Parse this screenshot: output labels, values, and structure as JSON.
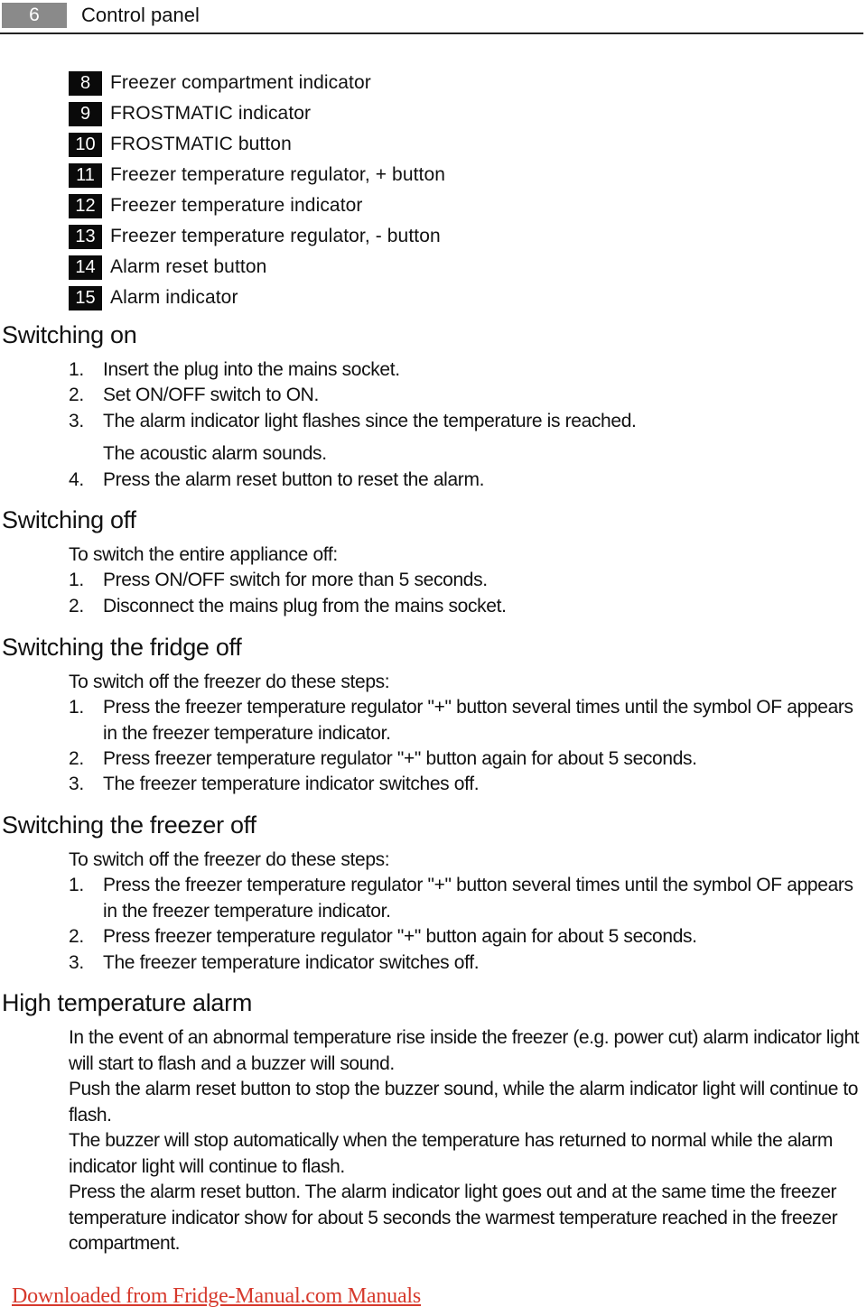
{
  "header": {
    "page_number": "6",
    "title": "Control panel"
  },
  "legend": [
    {
      "num": "8",
      "label": "Freezer compartment indicator"
    },
    {
      "num": "9",
      "label": "FROSTMATIC indicator"
    },
    {
      "num": "10",
      "label": "FROSTMATIC button"
    },
    {
      "num": "11",
      "label": "Freezer temperature regulator, + button"
    },
    {
      "num": "12",
      "label": "Freezer temperature indicator"
    },
    {
      "num": "13",
      "label": "Freezer temperature regulator, - button"
    },
    {
      "num": "14",
      "label": "Alarm reset button"
    },
    {
      "num": "15",
      "label": "Alarm indicator"
    }
  ],
  "switching_on": {
    "title": "Switching on",
    "steps": [
      {
        "n": "1.",
        "text": "Insert the plug into the mains socket."
      },
      {
        "n": "2.",
        "text": "Set ON/OFF switch to ON."
      },
      {
        "n": "3.",
        "text": "The alarm indicator light flashes since the temperature is reached."
      },
      {
        "n": "",
        "text": "The acoustic alarm sounds."
      },
      {
        "n": "4.",
        "text": "Press the alarm reset button to reset the alarm."
      }
    ]
  },
  "switching_off": {
    "title": "Switching off",
    "intro": "To switch the entire appliance off:",
    "steps": [
      {
        "n": "1.",
        "text": "Press ON/OFF switch for more than 5 seconds."
      },
      {
        "n": "2.",
        "text": "Disconnect the mains plug from the mains socket."
      }
    ]
  },
  "fridge_off": {
    "title": "Switching the fridge off",
    "intro": "To switch off the freezer do these steps:",
    "steps": [
      {
        "n": "1.",
        "text": "Press the freezer temperature regulator \"+\" button several times until the symbol OF appears in the freezer temperature indicator."
      },
      {
        "n": "2.",
        "text": "Press freezer temperature regulator \"+\" button again for about 5 seconds."
      },
      {
        "n": "3.",
        "text": "The freezer temperature indicator switches off."
      }
    ]
  },
  "freezer_off": {
    "title": "Switching the freezer off",
    "intro": "To switch off the freezer do these steps:",
    "steps": [
      {
        "n": "1.",
        "text": "Press the freezer temperature regulator \"+\" button several times until the symbol OF appears in the freezer temperature indicator."
      },
      {
        "n": "2.",
        "text": "Press freezer temperature regulator \"+\" button again for about 5 seconds."
      },
      {
        "n": "3.",
        "text": "The freezer temperature indicator switches off."
      }
    ]
  },
  "high_temp_alarm": {
    "title": "High temperature alarm",
    "paragraphs": [
      "In the event of an abnormal temperature rise inside the freezer (e.g. power cut) alarm indicator light will start to flash and a buzzer will sound.",
      "Push the alarm reset button to stop the buzzer sound, while the alarm indicator light will continue to flash.",
      "The buzzer will stop automatically when the temperature has returned to normal while the alarm indicator light will continue to flash.",
      "Press the alarm reset button. The alarm indicator light goes out and at the same time the freezer temperature indicator show for about 5 seconds the warmest temperature reached in the freezer compartment."
    ]
  },
  "footer": {
    "link_text": "Downloaded from Fridge-Manual.com Manuals",
    "link_color": "#d6392c"
  }
}
